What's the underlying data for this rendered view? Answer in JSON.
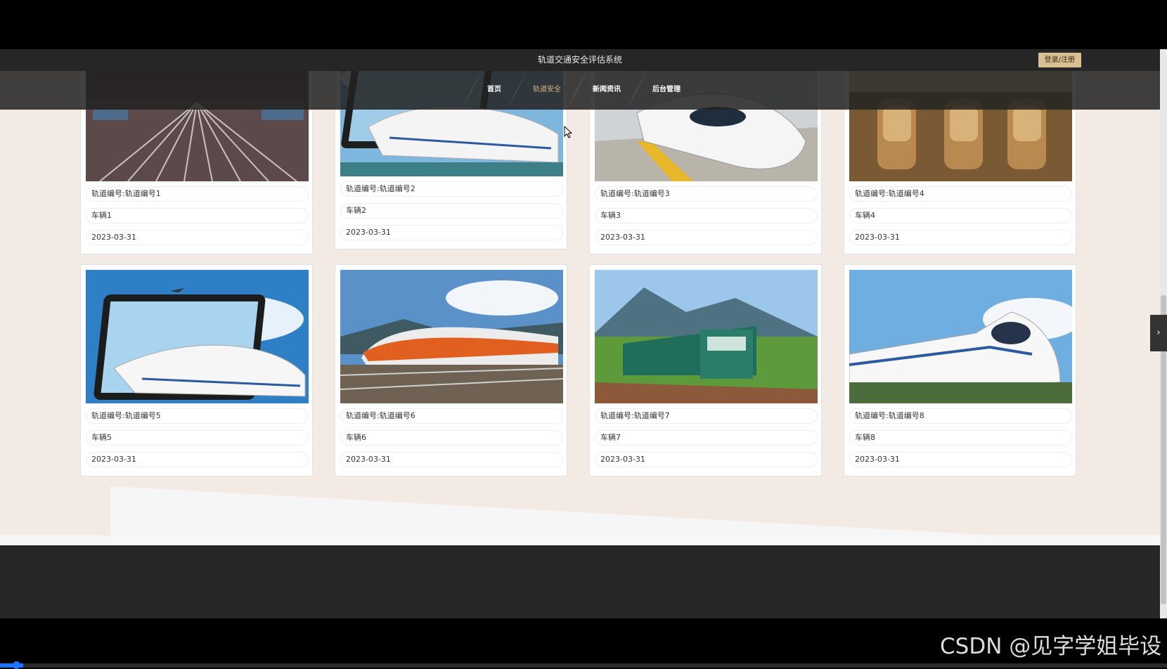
{
  "header": {
    "title": "轨道交通安全评估系统",
    "login_label": "登录/注册"
  },
  "nav": [
    {
      "label": "首页",
      "active": false
    },
    {
      "label": "轨道安全",
      "active": true
    },
    {
      "label": "新闻资讯",
      "active": false
    },
    {
      "label": "后台管理",
      "active": false
    }
  ],
  "cards": [
    {
      "track": "轨道编号:轨道编号1",
      "vehicle": "车辆1",
      "date": "2023-03-31",
      "image": "train-yard-night"
    },
    {
      "track": "轨道编号:轨道编号2",
      "vehicle": "车辆2",
      "date": "2023-03-31",
      "image": "train-from-tablet"
    },
    {
      "track": "轨道编号:轨道编号3",
      "vehicle": "车辆3",
      "date": "2023-03-31",
      "image": "train-at-platform"
    },
    {
      "track": "轨道编号:轨道编号4",
      "vehicle": "车辆4",
      "date": "2023-03-31",
      "image": "first-class-seats"
    },
    {
      "track": "轨道编号:轨道编号5",
      "vehicle": "车辆5",
      "date": "2023-03-31",
      "image": "train-from-tablet"
    },
    {
      "track": "轨道编号:轨道编号6",
      "vehicle": "车辆6",
      "date": "2023-03-31",
      "image": "orange-train"
    },
    {
      "track": "轨道编号:轨道编号7",
      "vehicle": "车辆7",
      "date": "2023-03-31",
      "image": "green-train-mountain"
    },
    {
      "track": "轨道编号:轨道编号8",
      "vehicle": "车辆8",
      "date": "2023-03-31",
      "image": "crh-train-bridge"
    }
  ],
  "watermark": "CSDN @见字学姐毕设",
  "colors": {
    "accent": "#d6b47c",
    "login_bg": "#d9bf91",
    "topbar": "#262626",
    "page_bg": "#f3ebe3",
    "footer": "#262626"
  },
  "icons": {
    "side_tab": "chevron-right-icon",
    "cursor": "mouse-pointer-icon"
  }
}
